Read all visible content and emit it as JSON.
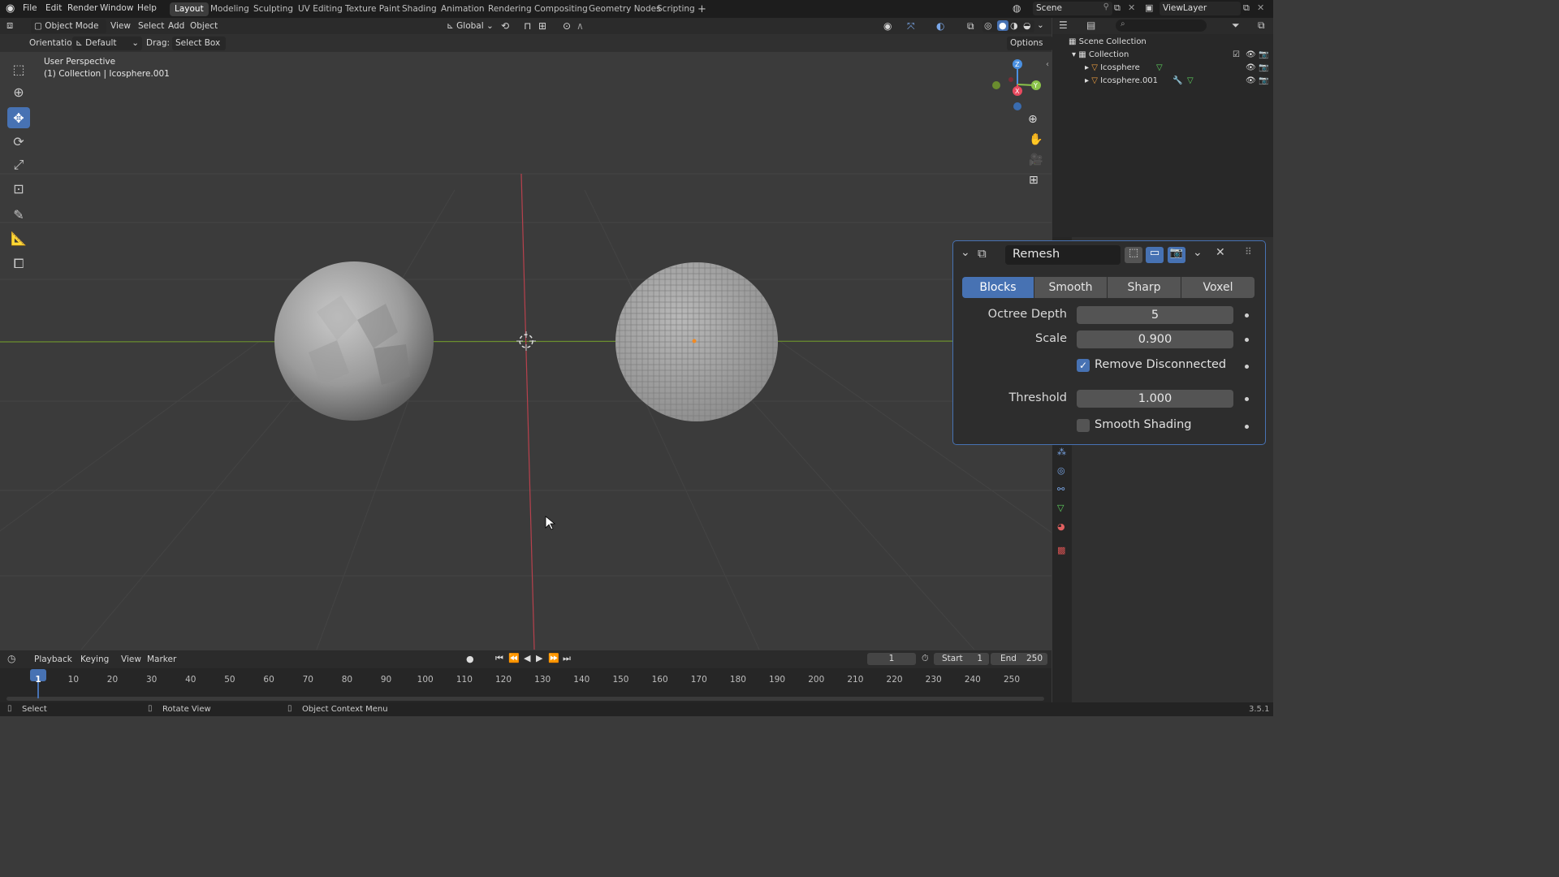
{
  "topbar": {
    "menus": [
      "File",
      "Edit",
      "Render",
      "Window",
      "Help"
    ],
    "workspaces": [
      "Layout",
      "Modeling",
      "Sculpting",
      "UV Editing",
      "Texture Paint",
      "Shading",
      "Animation",
      "Rendering",
      "Compositing",
      "Geometry Nodes",
      "Scripting"
    ],
    "active_workspace": "Layout",
    "add_tab": "+",
    "scene": "Scene",
    "view_layer": "ViewLayer"
  },
  "viewport_header": {
    "mode": "Object Mode",
    "menus": [
      "View",
      "Select",
      "Add",
      "Object"
    ],
    "transform_orientation": "Global",
    "orientation_label": "Orientation:",
    "orientation_value": "Default",
    "drag_label": "Drag:",
    "drag_value": "Select Box",
    "options": "Options"
  },
  "viewport": {
    "perspective": "User Perspective",
    "context": "(1) Collection | Icosphere.001",
    "gizmo_axes": [
      "Z",
      "X",
      "Y"
    ]
  },
  "outliner": {
    "root": "Scene Collection",
    "collection": "Collection",
    "objects": [
      "Icosphere",
      "Icosphere.001"
    ]
  },
  "remesh_panel": {
    "modifier_name": "Remesh",
    "modes": [
      "Blocks",
      "Smooth",
      "Sharp",
      "Voxel"
    ],
    "active_mode": "Blocks",
    "octree_depth_label": "Octree Depth",
    "octree_depth": "5",
    "scale_label": "Scale",
    "scale": "0.900",
    "remove_disconnected_label": "Remove Disconnected",
    "remove_disconnected": true,
    "threshold_label": "Threshold",
    "threshold": "1.000",
    "smooth_shading_label": "Smooth Shading",
    "smooth_shading": false
  },
  "timeline": {
    "menus": [
      "Playback",
      "Keying",
      "View",
      "Marker"
    ],
    "current_frame": "1",
    "start_label": "Start",
    "start": "1",
    "end_label": "End",
    "end": "250",
    "ticks": [
      "1",
      "10",
      "20",
      "30",
      "40",
      "50",
      "60",
      "70",
      "80",
      "90",
      "100",
      "110",
      "120",
      "130",
      "140",
      "150",
      "160",
      "170",
      "180",
      "190",
      "200",
      "210",
      "220",
      "230",
      "240",
      "250"
    ]
  },
  "statusbar": {
    "select": "Select",
    "rotate": "Rotate View",
    "context_menu": "Object Context Menu",
    "version": "3.5.1"
  },
  "colors": {
    "accent": "#4772b3",
    "x_axis": "#e84a5f",
    "y_axis": "#8bc34a",
    "z_axis": "#4a90e2"
  }
}
